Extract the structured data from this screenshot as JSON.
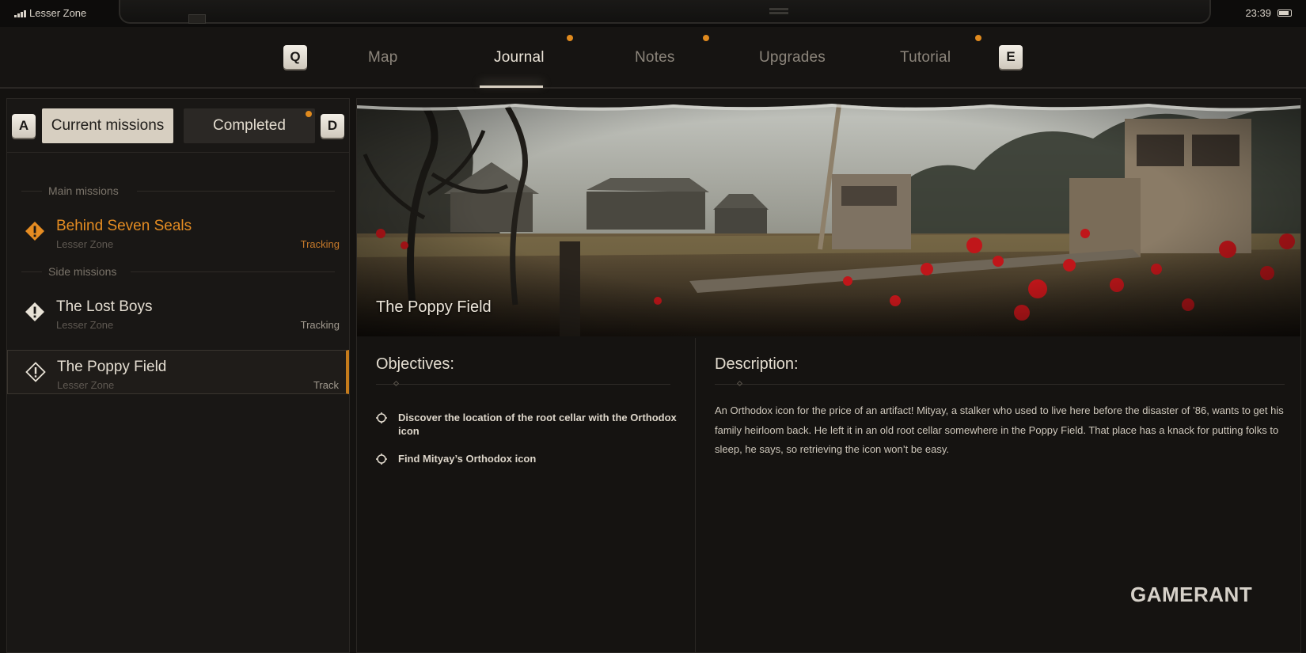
{
  "status_bar": {
    "zone": "Lesser Zone",
    "time": "23:39"
  },
  "nav": {
    "prev_key": "Q",
    "next_key": "E",
    "tabs": [
      {
        "label": "Map",
        "has_dot": false
      },
      {
        "label": "Journal",
        "has_dot": true,
        "active": true
      },
      {
        "label": "Notes",
        "has_dot": true
      },
      {
        "label": "Upgrades",
        "has_dot": false
      },
      {
        "label": "Tutorial",
        "has_dot": true
      }
    ]
  },
  "missions_panel": {
    "prev_key": "A",
    "next_key": "D",
    "tab_current": "Current missions",
    "tab_completed": "Completed",
    "main_section": "Main missions",
    "side_section": "Side missions",
    "main_missions": [
      {
        "title": "Behind Seven Seals",
        "location": "Lesser Zone",
        "status": "Tracking",
        "color": "#e58c22"
      }
    ],
    "side_missions": [
      {
        "title": "The Lost Boys",
        "location": "Lesser Zone",
        "status": "Tracking"
      },
      {
        "title": "The Poppy Field",
        "location": "Lesser Zone",
        "status": "Track",
        "selected": true
      }
    ]
  },
  "detail": {
    "banner_title": "The Poppy Field",
    "objectives_title": "Objectives:",
    "objectives": [
      "Discover the location of the root cellar with the Orthodox icon",
      "Find Mityay’s Orthodox icon"
    ],
    "description_title": "Description:",
    "description": "An Orthodox icon for the price of an artifact! Mityay, a stalker who used to live here before the disaster of ’86, wants to get his family heirloom back. He left it in an old root cellar somewhere in the Poppy Field. That place has a knack for putting folks to sleep, he says, so retrieving the icon won’t be easy."
  },
  "watermark": {
    "part1": "GAME",
    "part2": "RANT"
  },
  "colors": {
    "accent": "#e08a1e",
    "mission_orange": "#e58c22"
  }
}
